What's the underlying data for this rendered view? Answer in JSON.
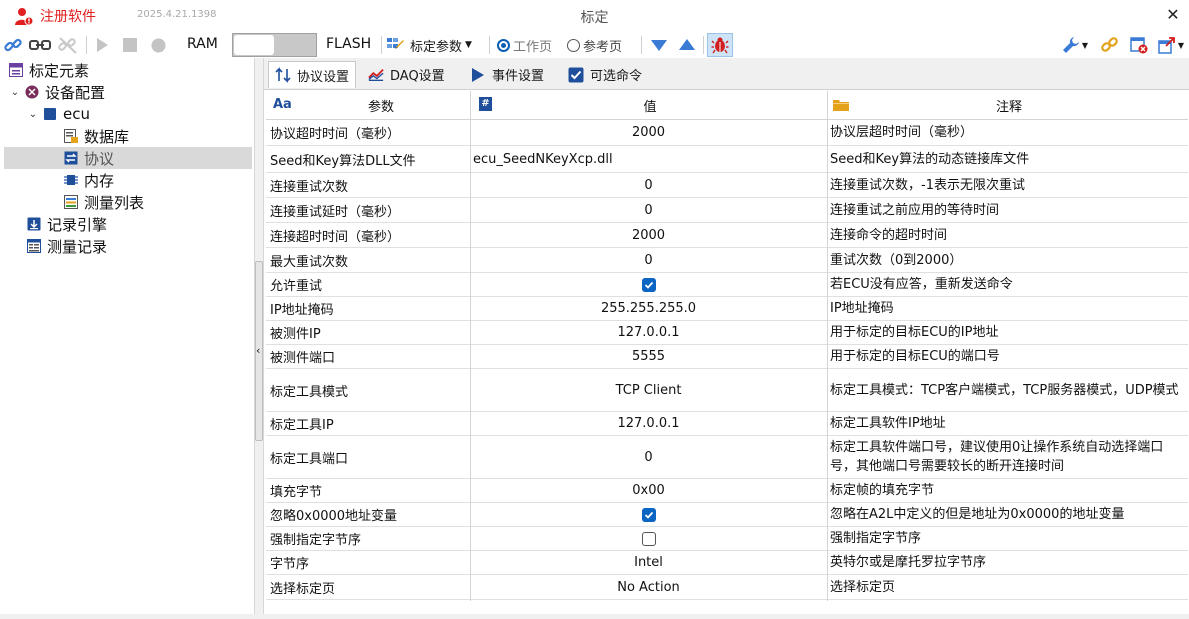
{
  "titlebar": {
    "register_label": "注册软件",
    "version": "2025.4.21.1398",
    "window_title": "标定",
    "close_glyph": "✕"
  },
  "toolbar": {
    "ram_label": "RAM",
    "flash_label": "FLASH",
    "calib_params_label": "标定参数",
    "working_page_label": "工作页",
    "reference_page_label": "参考页",
    "icons": [
      "link-icon",
      "connect-icon",
      "disconnect-icon",
      "play-icon",
      "stop-icon",
      "record-icon",
      "calibration-params-icon",
      "dropdown-arrow-icon",
      "down-triangle-icon",
      "up-triangle-icon",
      "bug-icon",
      "wrench-icon",
      "chain-icon",
      "clear-icon",
      "export-icon"
    ]
  },
  "tree": {
    "root": "标定元素",
    "device_config": "设备配置",
    "ecu": "ecu",
    "database": "数据库",
    "protocol": "协议",
    "memory": "内存",
    "measurement_list": "测量列表",
    "record_engine": "记录引擎",
    "measurement_record": "测量记录"
  },
  "tabs": [
    {
      "label": "协议设置",
      "icon": "protocol-settings-icon"
    },
    {
      "label": "DAQ设置",
      "icon": "daq-chart-icon"
    },
    {
      "label": "事件设置",
      "icon": "event-play-icon"
    },
    {
      "label": "可选命令",
      "icon": "optional-command-checkbox-icon"
    }
  ],
  "columns": {
    "param": "参数",
    "value": "值",
    "note": "注释",
    "param_icon_text": "Aa",
    "value_icon_text": "#"
  },
  "rows": [
    {
      "param": "协议超时时间（毫秒）",
      "value": "2000",
      "note": "协议层超时时间（毫秒）"
    },
    {
      "param": "Seed和Key算法DLL文件",
      "value": "ecu_SeedNKeyXcp.dll",
      "note": "Seed和Key算法的动态链接库文件"
    },
    {
      "param": "连接重试次数",
      "value": "0",
      "note": "连接重试次数，-1表示无限次重试"
    },
    {
      "param": "连接重试延时（毫秒）",
      "value": "0",
      "note": "连接重试之前应用的等待时间"
    },
    {
      "param": "连接超时时间（毫秒）",
      "value": "2000",
      "note": "连接命令的超时时间"
    },
    {
      "param": "最大重试次数",
      "value": "0",
      "note": "重试次数（0到2000）"
    },
    {
      "param": "允许重试",
      "checked": true,
      "note": "若ECU没有应答，重新发送命令"
    },
    {
      "param": "IP地址掩码",
      "value": "255.255.255.0",
      "note": "IP地址掩码"
    },
    {
      "param": "被测件IP",
      "value": "127.0.0.1",
      "note": "用于标定的目标ECU的IP地址"
    },
    {
      "param": "被测件端口",
      "value": "5555",
      "note": "用于标定的目标ECU的端口号"
    },
    {
      "param": "标定工具模式",
      "value": "TCP Client",
      "note": "标定工具模式：TCP客户端模式，TCP服务器模式，UDP模式"
    },
    {
      "param": "标定工具IP",
      "value": "127.0.0.1",
      "note": "标定工具软件IP地址"
    },
    {
      "param": "标定工具端口",
      "value": "0",
      "note": "标定工具软件端口号，建议使用0让操作系统自动选择端口号，其他端口号需要较长的断开连接时间"
    },
    {
      "param": "填充字节",
      "value": "0x00",
      "note": "标定帧的填充字节"
    },
    {
      "param": "忽略0x0000地址变量",
      "checked": true,
      "note": "忽略在A2L中定义的但是地址为0x0000的地址变量"
    },
    {
      "param": "强制指定字节序",
      "checked": false,
      "note": "强制指定字节序"
    },
    {
      "param": "字节序",
      "value": "Intel",
      "note": "英特尔或是摩托罗拉字节序"
    },
    {
      "param": "选择标定页",
      "value": "No Action",
      "note": "选择标定页"
    }
  ],
  "colors": {
    "accent": "#0b65c2",
    "register_red": "#e02020",
    "selection_gray": "#d9d9d9",
    "icon_blue": "#3a7bd5"
  }
}
